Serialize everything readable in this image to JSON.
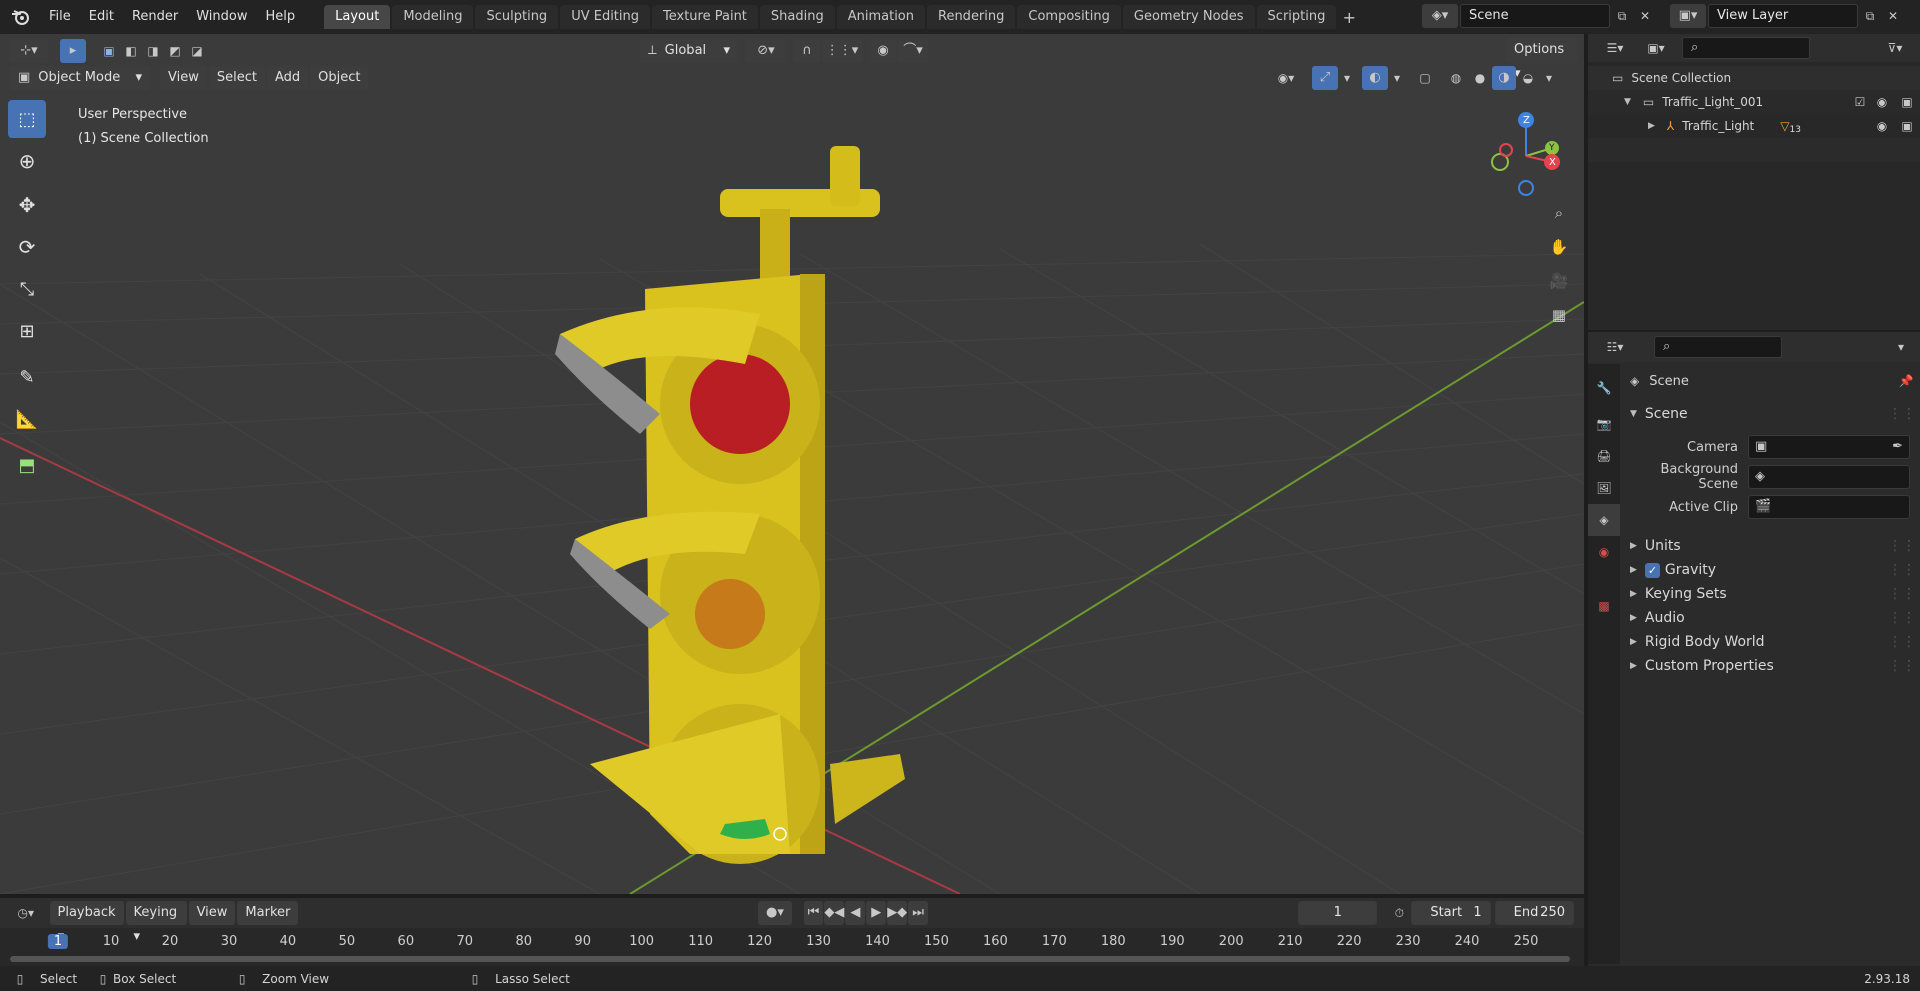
{
  "topbar": {
    "menus": [
      "File",
      "Edit",
      "Render",
      "Window",
      "Help"
    ],
    "workspaces": [
      "Layout",
      "Modeling",
      "Sculpting",
      "UV Editing",
      "Texture Paint",
      "Shading",
      "Animation",
      "Rendering",
      "Compositing",
      "Geometry Nodes",
      "Scripting"
    ],
    "active_workspace": "Layout",
    "scene_name": "Scene",
    "view_layer": "View Layer"
  },
  "viewport": {
    "transform_orientation": "Global",
    "options_label": "Options",
    "mode": "Object Mode",
    "menus": [
      "View",
      "Select",
      "Add",
      "Object"
    ],
    "overlay_title": "User Perspective",
    "overlay_collection": "(1) Scene Collection",
    "gizmo_axes": [
      "Z",
      "Y",
      "X"
    ]
  },
  "outliner": {
    "root": "Scene Collection",
    "collection": "Traffic_Light_001",
    "object": "Traffic_Light",
    "modifier_count": "13"
  },
  "properties": {
    "breadcrumb": "Scene",
    "section": "Scene",
    "fields": [
      {
        "label": "Camera",
        "icon": "camera-object-icon"
      },
      {
        "label": "Background Scene",
        "icon": "scene-icon"
      },
      {
        "label": "Active Clip",
        "icon": "clip-icon"
      }
    ],
    "panels": [
      "Units",
      "Gravity",
      "Keying Sets",
      "Audio",
      "Rigid Body World",
      "Custom Properties"
    ],
    "gravity_checked": true
  },
  "timeline": {
    "menus": [
      "Playback",
      "Keying",
      "View",
      "Marker"
    ],
    "current_frame": "1",
    "start_label": "Start",
    "start_value": "1",
    "end_label": "End",
    "end_value": "250",
    "ticks": [
      "1",
      "10",
      "20",
      "30",
      "40",
      "50",
      "60",
      "70",
      "80",
      "90",
      "100",
      "110",
      "120",
      "130",
      "140",
      "150",
      "160",
      "170",
      "180",
      "190",
      "200",
      "210",
      "220",
      "230",
      "240",
      "250"
    ]
  },
  "statusbar": {
    "select": "Select",
    "box_select": "Box Select",
    "zoom_view": "Zoom View",
    "lasso_select": "Lasso Select",
    "version": "2.93.18"
  },
  "colors": {
    "accent": "#4772b3",
    "x_axis": "#e2444f",
    "y_axis": "#8bc240",
    "z_axis": "#3d84e3",
    "traffic_light_yellow": "#d9c21e"
  }
}
